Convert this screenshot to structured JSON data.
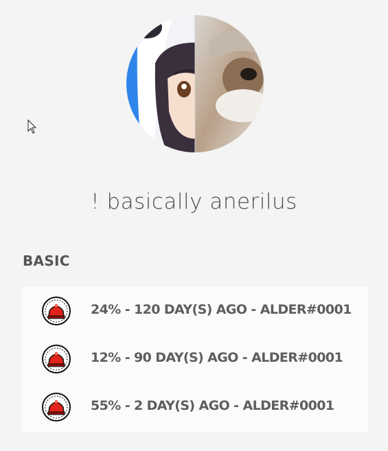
{
  "profile": {
    "display_name": "! basically anerilus"
  },
  "section": {
    "title": "BASIC"
  },
  "badges": [
    {
      "icon": "red-cake-badge-icon",
      "text": "24% - 120 DAY(S) AGO - ALDER#0001"
    },
    {
      "icon": "red-cake-badge-icon",
      "text": "12% - 90 DAY(S) AGO - ALDER#0001"
    },
    {
      "icon": "red-cake-badge-icon",
      "text": "55% - 2 DAY(S) AGO - ALDER#0001"
    }
  ],
  "colors": {
    "background": "#f4f4f4",
    "list_background": "#fbfbfb",
    "text": "#5e5e5e",
    "badge_red": "#e2231a"
  }
}
